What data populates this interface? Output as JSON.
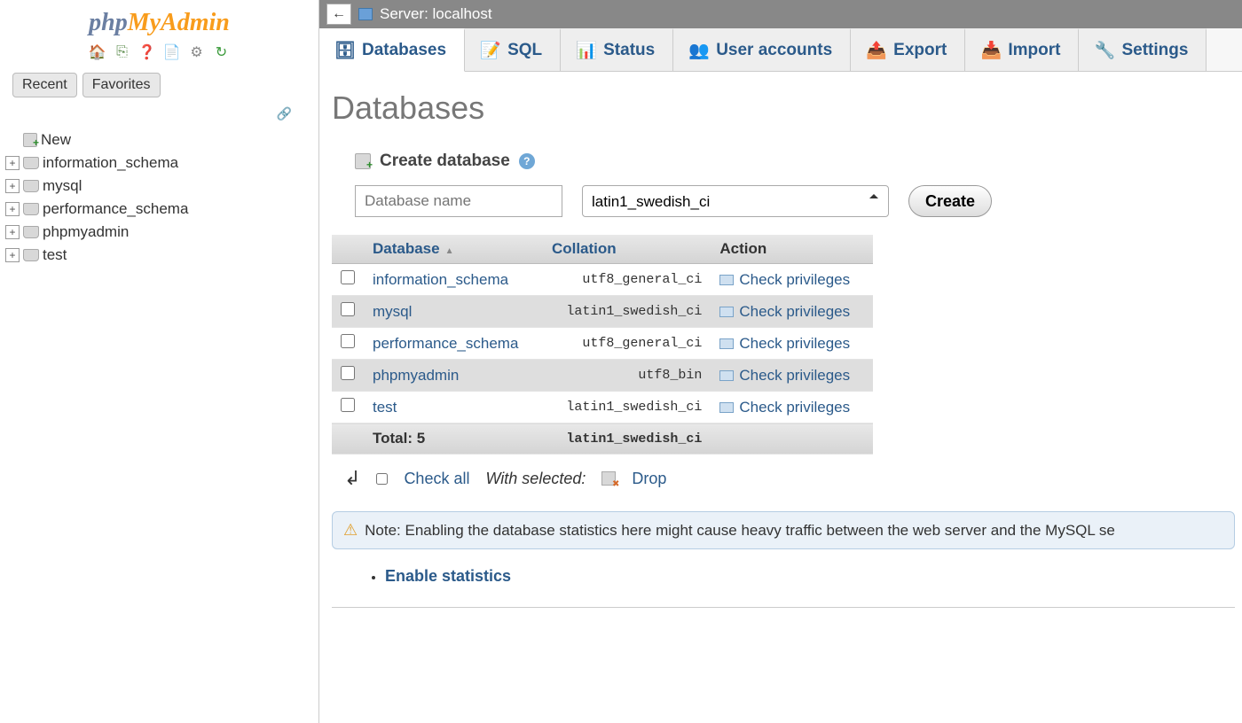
{
  "logo": {
    "part1": "php",
    "part2": "MyAdmin"
  },
  "sidebar": {
    "tabs": {
      "recent": "Recent",
      "favorites": "Favorites"
    },
    "new_label": "New",
    "items": [
      {
        "label": "information_schema"
      },
      {
        "label": "mysql"
      },
      {
        "label": "performance_schema"
      },
      {
        "label": "phpmyadmin"
      },
      {
        "label": "test"
      }
    ]
  },
  "topbar": {
    "server_label": "Server: localhost"
  },
  "maintabs": {
    "databases": "Databases",
    "sql": "SQL",
    "status": "Status",
    "user_accounts": "User accounts",
    "export": "Export",
    "import": "Import",
    "settings": "Settings"
  },
  "page": {
    "title": "Databases",
    "create_label": "Create database",
    "dbname_placeholder": "Database name",
    "collation_selected": "latin1_swedish_ci",
    "create_button": "Create"
  },
  "table": {
    "headers": {
      "database": "Database",
      "collation": "Collation",
      "action": "Action"
    },
    "action_label": "Check privileges",
    "rows": [
      {
        "name": "information_schema",
        "collation": "utf8_general_ci"
      },
      {
        "name": "mysql",
        "collation": "latin1_swedish_ci"
      },
      {
        "name": "performance_schema",
        "collation": "utf8_general_ci"
      },
      {
        "name": "phpmyadmin",
        "collation": "utf8_bin"
      },
      {
        "name": "test",
        "collation": "latin1_swedish_ci"
      }
    ],
    "footer": {
      "total_label": "Total: 5",
      "collation": "latin1_swedish_ci"
    }
  },
  "bulk": {
    "check_all": "Check all",
    "with_selected": "With selected:",
    "drop": "Drop"
  },
  "note": "Note: Enabling the database statistics here might cause heavy traffic between the web server and the MySQL se",
  "enable_stats": "Enable statistics"
}
